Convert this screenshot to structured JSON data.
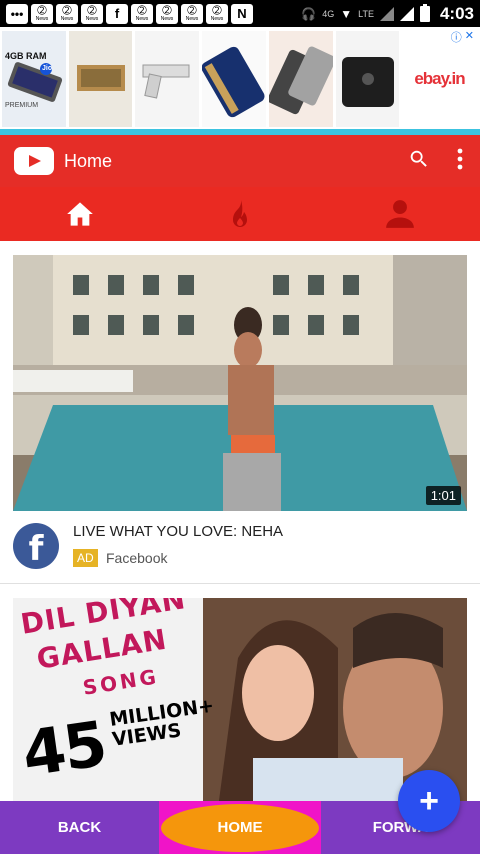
{
  "status_bar": {
    "notification_badge": "News",
    "network": "4G",
    "lte": "LTE",
    "time": "4:03"
  },
  "ad_banner": {
    "tile1_label": "4GB RAM",
    "tile1_brand": "Jio",
    "tile1_sub": "PREMIUM",
    "ebay_logo": "ebay.in",
    "ad_choices_icons": [
      "info-icon",
      "close-icon"
    ]
  },
  "app_bar": {
    "title": "Home",
    "actions": [
      "search-icon",
      "more-vert-icon"
    ]
  },
  "tabs": [
    {
      "name": "home-icon",
      "active": true
    },
    {
      "name": "trending-icon",
      "active": false
    },
    {
      "name": "account-icon",
      "active": false
    }
  ],
  "feed": {
    "video1": {
      "duration": "1:01",
      "title": "LIVE WHAT YOU LOVE: NEHA",
      "badge": "AD",
      "channel": "Facebook",
      "avatar_letter": "f"
    },
    "video2": {
      "line1": "DIL DIYAN",
      "line2": "GALLAN",
      "line3": "SONG",
      "count": "45",
      "million": "MILLION+",
      "views": "VIEWS"
    }
  },
  "bottom_nav": {
    "back": "BACK",
    "home": "HOME",
    "forward": "FORWA"
  },
  "fab": {
    "label": "+"
  },
  "colors": {
    "app_bar": "#e52d27",
    "tab_bar": "#ea2a22",
    "bottom_nav": "#7d3ac1",
    "home_highlight": "#f014c8",
    "home_pill": "#f5960c",
    "fab": "#2a4ff0"
  }
}
